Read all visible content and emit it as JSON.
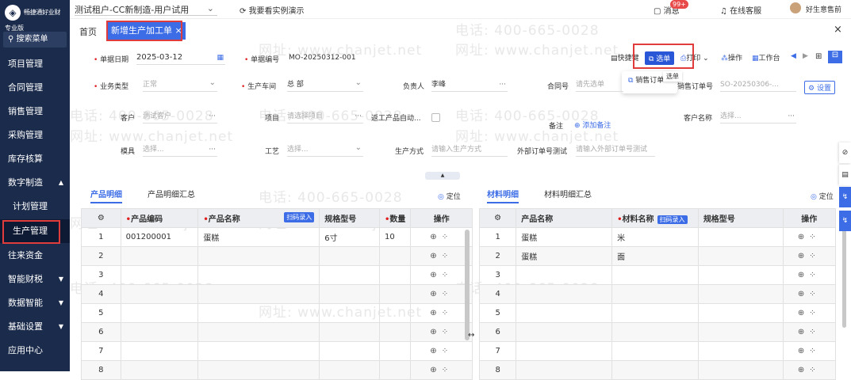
{
  "sidebar": {
    "brand": "畅捷通好业财",
    "edition": "专业版",
    "search_label": "搜索菜单",
    "items": [
      {
        "label": "项目管理"
      },
      {
        "label": "合同管理"
      },
      {
        "label": "销售管理"
      },
      {
        "label": "采购管理"
      },
      {
        "label": "库存核算"
      },
      {
        "label": "数字制造",
        "arrow": "▲"
      },
      {
        "label": "计划管理"
      },
      {
        "label": "生产管理"
      },
      {
        "label": "往来资金"
      },
      {
        "label": "智能财税",
        "arrow": "▼"
      },
      {
        "label": "数据智能",
        "arrow": "▼"
      },
      {
        "label": "基础设置",
        "arrow": "▼"
      },
      {
        "label": "应用中心"
      }
    ]
  },
  "topbar": {
    "account": "测试租户-CC新制造-用户试用",
    "demo": "我要看实例演示",
    "message": "消息",
    "badge": "99+",
    "service": "在线客服",
    "user": "好生意售前"
  },
  "tabs": {
    "home": "首页",
    "active": "新增生产加工单",
    "close": "×",
    "window_close": "×"
  },
  "watermark": {
    "phone": "电话: 400-665-0028",
    "site": "网址: www.chanjet.net"
  },
  "toolbar": {
    "shortcut": "快捷键",
    "select": "选单",
    "print": "打印",
    "operation": "操作",
    "workbench": "工作台",
    "dropdown_item": "销售订单",
    "tooltip": "选单"
  },
  "form": {
    "date_label": "单据日期",
    "date_value": "2025-03-12",
    "code_label": "单据编号",
    "code_value": "MO-20250312-001",
    "biztype_label": "业务类型",
    "biztype_value": "正常",
    "workshop_label": "生产车间",
    "workshop_value": "总 部",
    "owner_label": "负责人",
    "owner_value": "李峰",
    "contract_label": "合同号",
    "contract_ph": "请先选单",
    "so_label": "销售订单号",
    "so_value": "SO-20250306-...",
    "settings": "设置",
    "customer_label": "客户",
    "customer_ph": "测试客户",
    "project_label": "项目",
    "project_ph": "请选择项目",
    "rework_label": "返工产品自动...",
    "remark_label": "备注",
    "remark_add": "添加备注",
    "custname_label": "客户名称",
    "custname_ph": "选择...",
    "mold_label": "模具",
    "mold_ph": "选择...",
    "process_label": "工艺",
    "process_ph": "选择...",
    "method_label": "生产方式",
    "method_ph": "请输入生产方式",
    "extso_label": "外部订单号测试",
    "extso_ph": "请输入外部订单号测试"
  },
  "left_section": {
    "tab1": "产品明细",
    "tab2": "产品明细汇总",
    "locate": "定位",
    "headers": {
      "code": "产品编码",
      "name": "产品名称",
      "scan": "扫码录入",
      "spec": "规格型号",
      "qty": "数量",
      "op": "操作"
    },
    "rows": [
      {
        "no": "1",
        "code": "001200001",
        "name": "蛋糕",
        "spec": "6寸",
        "qty": "10"
      },
      {
        "no": "2",
        "code": "",
        "name": "",
        "spec": "",
        "qty": ""
      },
      {
        "no": "3",
        "code": "",
        "name": "",
        "spec": "",
        "qty": ""
      },
      {
        "no": "4",
        "code": "",
        "name": "",
        "spec": "",
        "qty": ""
      },
      {
        "no": "5",
        "code": "",
        "name": "",
        "spec": "",
        "qty": ""
      },
      {
        "no": "6",
        "code": "",
        "name": "",
        "spec": "",
        "qty": ""
      },
      {
        "no": "7",
        "code": "",
        "name": "",
        "spec": "",
        "qty": ""
      },
      {
        "no": "8",
        "code": "",
        "name": "",
        "spec": "",
        "qty": ""
      }
    ]
  },
  "right_section": {
    "tab1": "材料明细",
    "tab2": "材料明细汇总",
    "locate": "定位",
    "headers": {
      "prod": "产品名称",
      "mat": "材料名称",
      "scan": "扫码录入",
      "spec": "规格型号",
      "op": "操作"
    },
    "rows": [
      {
        "no": "1",
        "prod": "蛋糕",
        "mat": "米",
        "spec": ""
      },
      {
        "no": "2",
        "prod": "蛋糕",
        "mat": "面",
        "spec": ""
      },
      {
        "no": "3",
        "prod": "",
        "mat": "",
        "spec": ""
      },
      {
        "no": "4",
        "prod": "",
        "mat": "",
        "spec": ""
      },
      {
        "no": "5",
        "prod": "",
        "mat": "",
        "spec": ""
      },
      {
        "no": "6",
        "prod": "",
        "mat": "",
        "spec": ""
      },
      {
        "no": "7",
        "prod": "",
        "mat": "",
        "spec": ""
      },
      {
        "no": "8",
        "prod": "",
        "mat": "",
        "spec": ""
      }
    ]
  },
  "colors": {
    "sidebar": "#1b2b4b",
    "accent": "#3d6de6",
    "highlight": "#e03c3c"
  }
}
